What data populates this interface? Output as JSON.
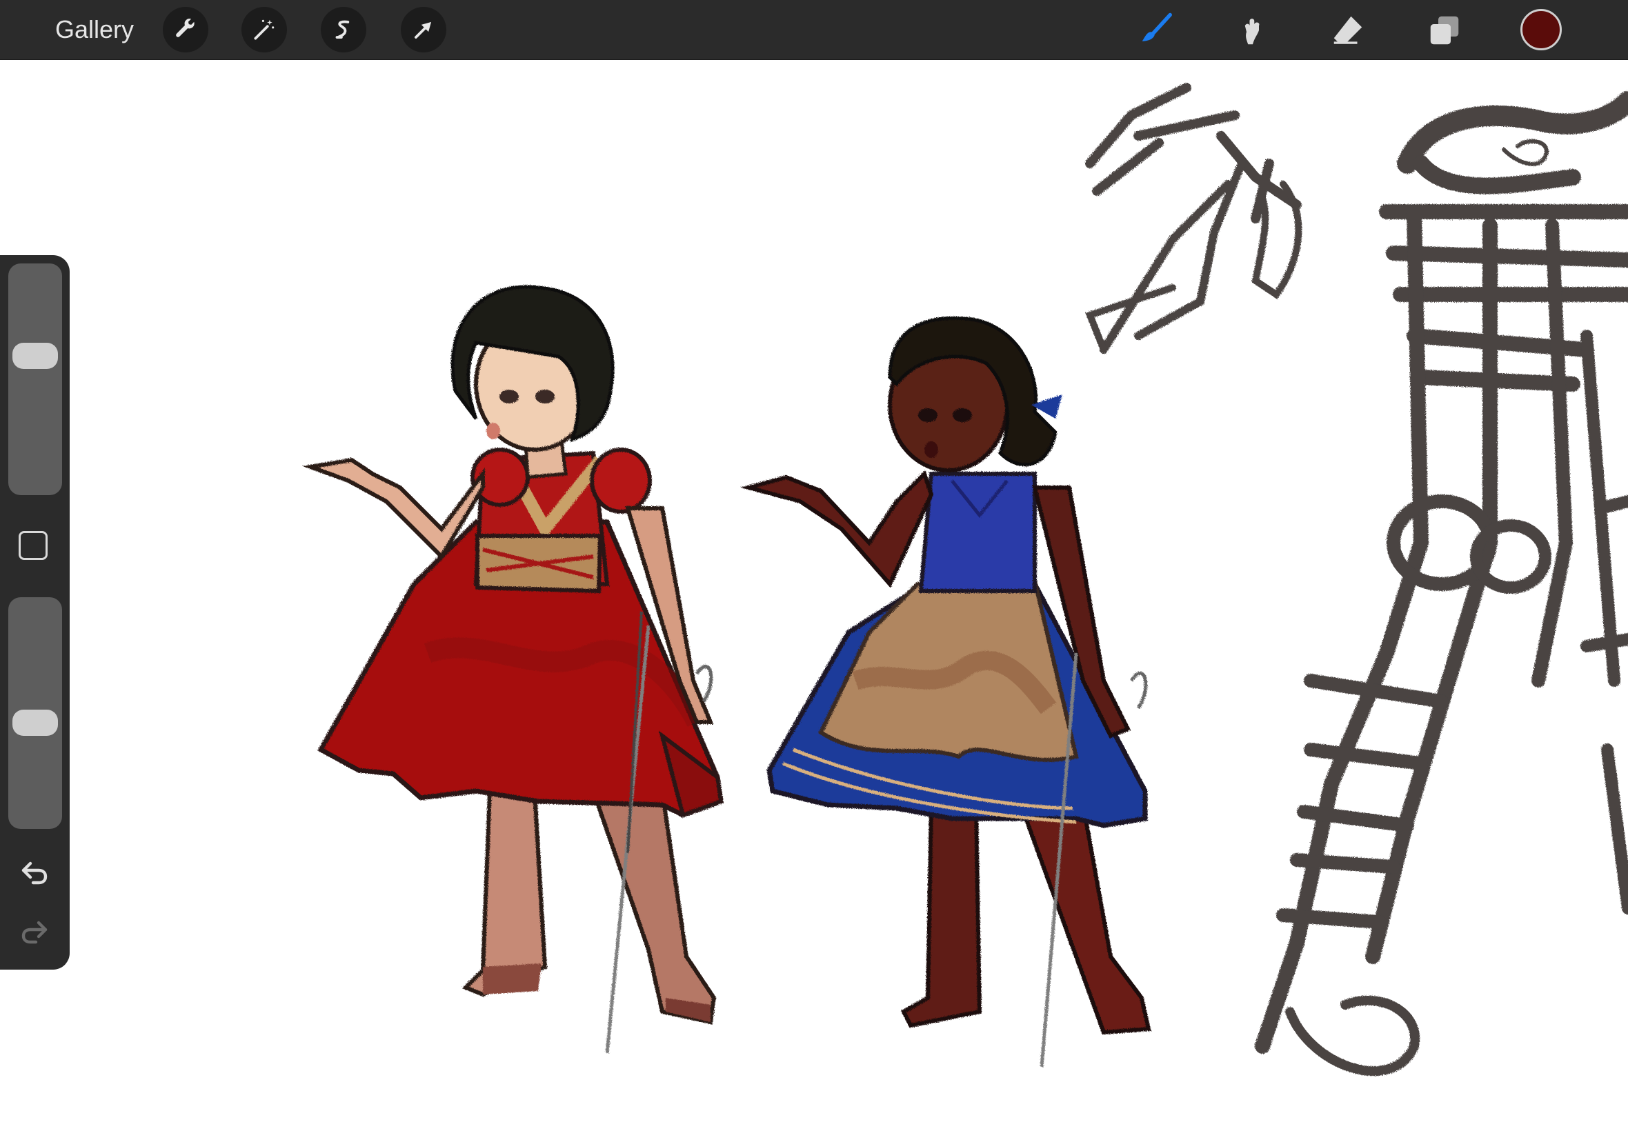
{
  "toolbar": {
    "gallery_label": "Gallery",
    "left_actions": [
      {
        "name": "actions-wrench-icon"
      },
      {
        "name": "adjustments-wand-icon"
      },
      {
        "name": "selection-icon"
      },
      {
        "name": "transform-arrow-icon"
      }
    ],
    "right_tools": [
      {
        "name": "brush-icon",
        "active": true
      },
      {
        "name": "smudge-icon"
      },
      {
        "name": "eraser-icon"
      },
      {
        "name": "layers-icon"
      }
    ],
    "current_color": "#5a0c0a",
    "active_tool_color": "#1a7cf0"
  },
  "sidebar": {
    "brush_size_level": 0.62,
    "opacity_level": 0.45
  },
  "canvas": {
    "background": "#ffffff"
  }
}
